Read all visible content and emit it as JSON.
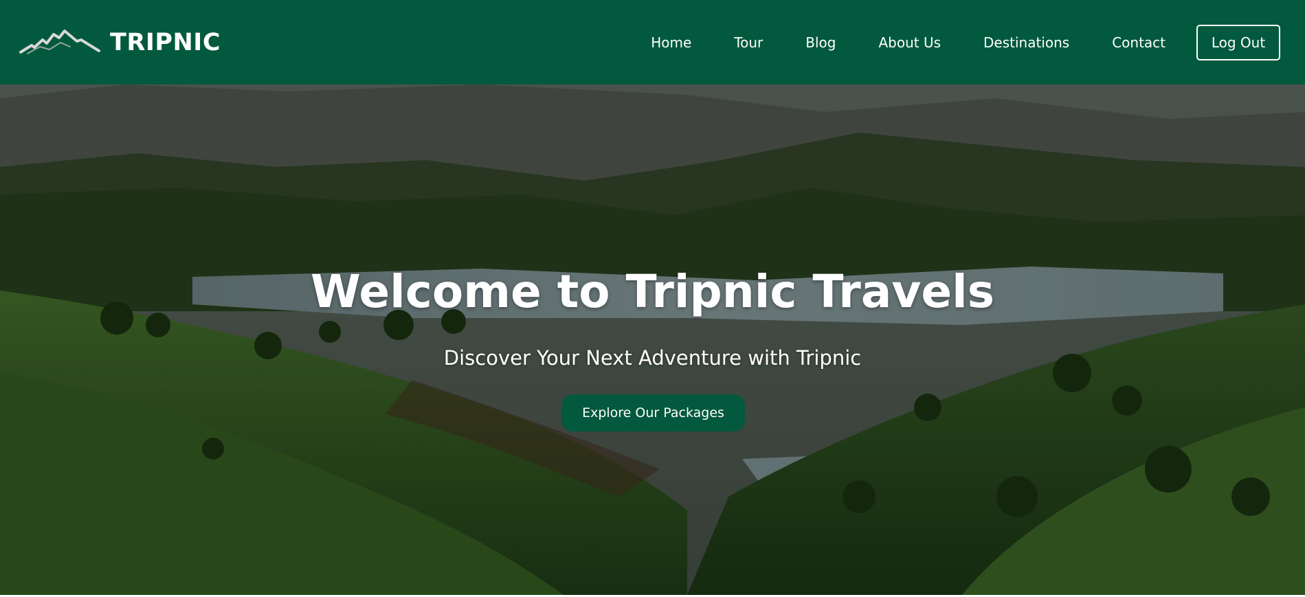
{
  "navbar": {
    "brand_name": "TRIPNIC",
    "logo_icon": "mountain-icon",
    "bg_color": "#03593e",
    "links": [
      {
        "label": "Home"
      },
      {
        "label": "Tour"
      },
      {
        "label": "Blog"
      },
      {
        "label": "About Us"
      },
      {
        "label": "Destinations"
      },
      {
        "label": "Contact"
      }
    ],
    "logout_label": "Log Out"
  },
  "hero": {
    "title": "Welcome to Tripnic Travels",
    "subtitle": "Discover Your Next Adventure with Tripnic",
    "cta_label": "Explore Our Packages",
    "cta_color": "#03593e"
  }
}
